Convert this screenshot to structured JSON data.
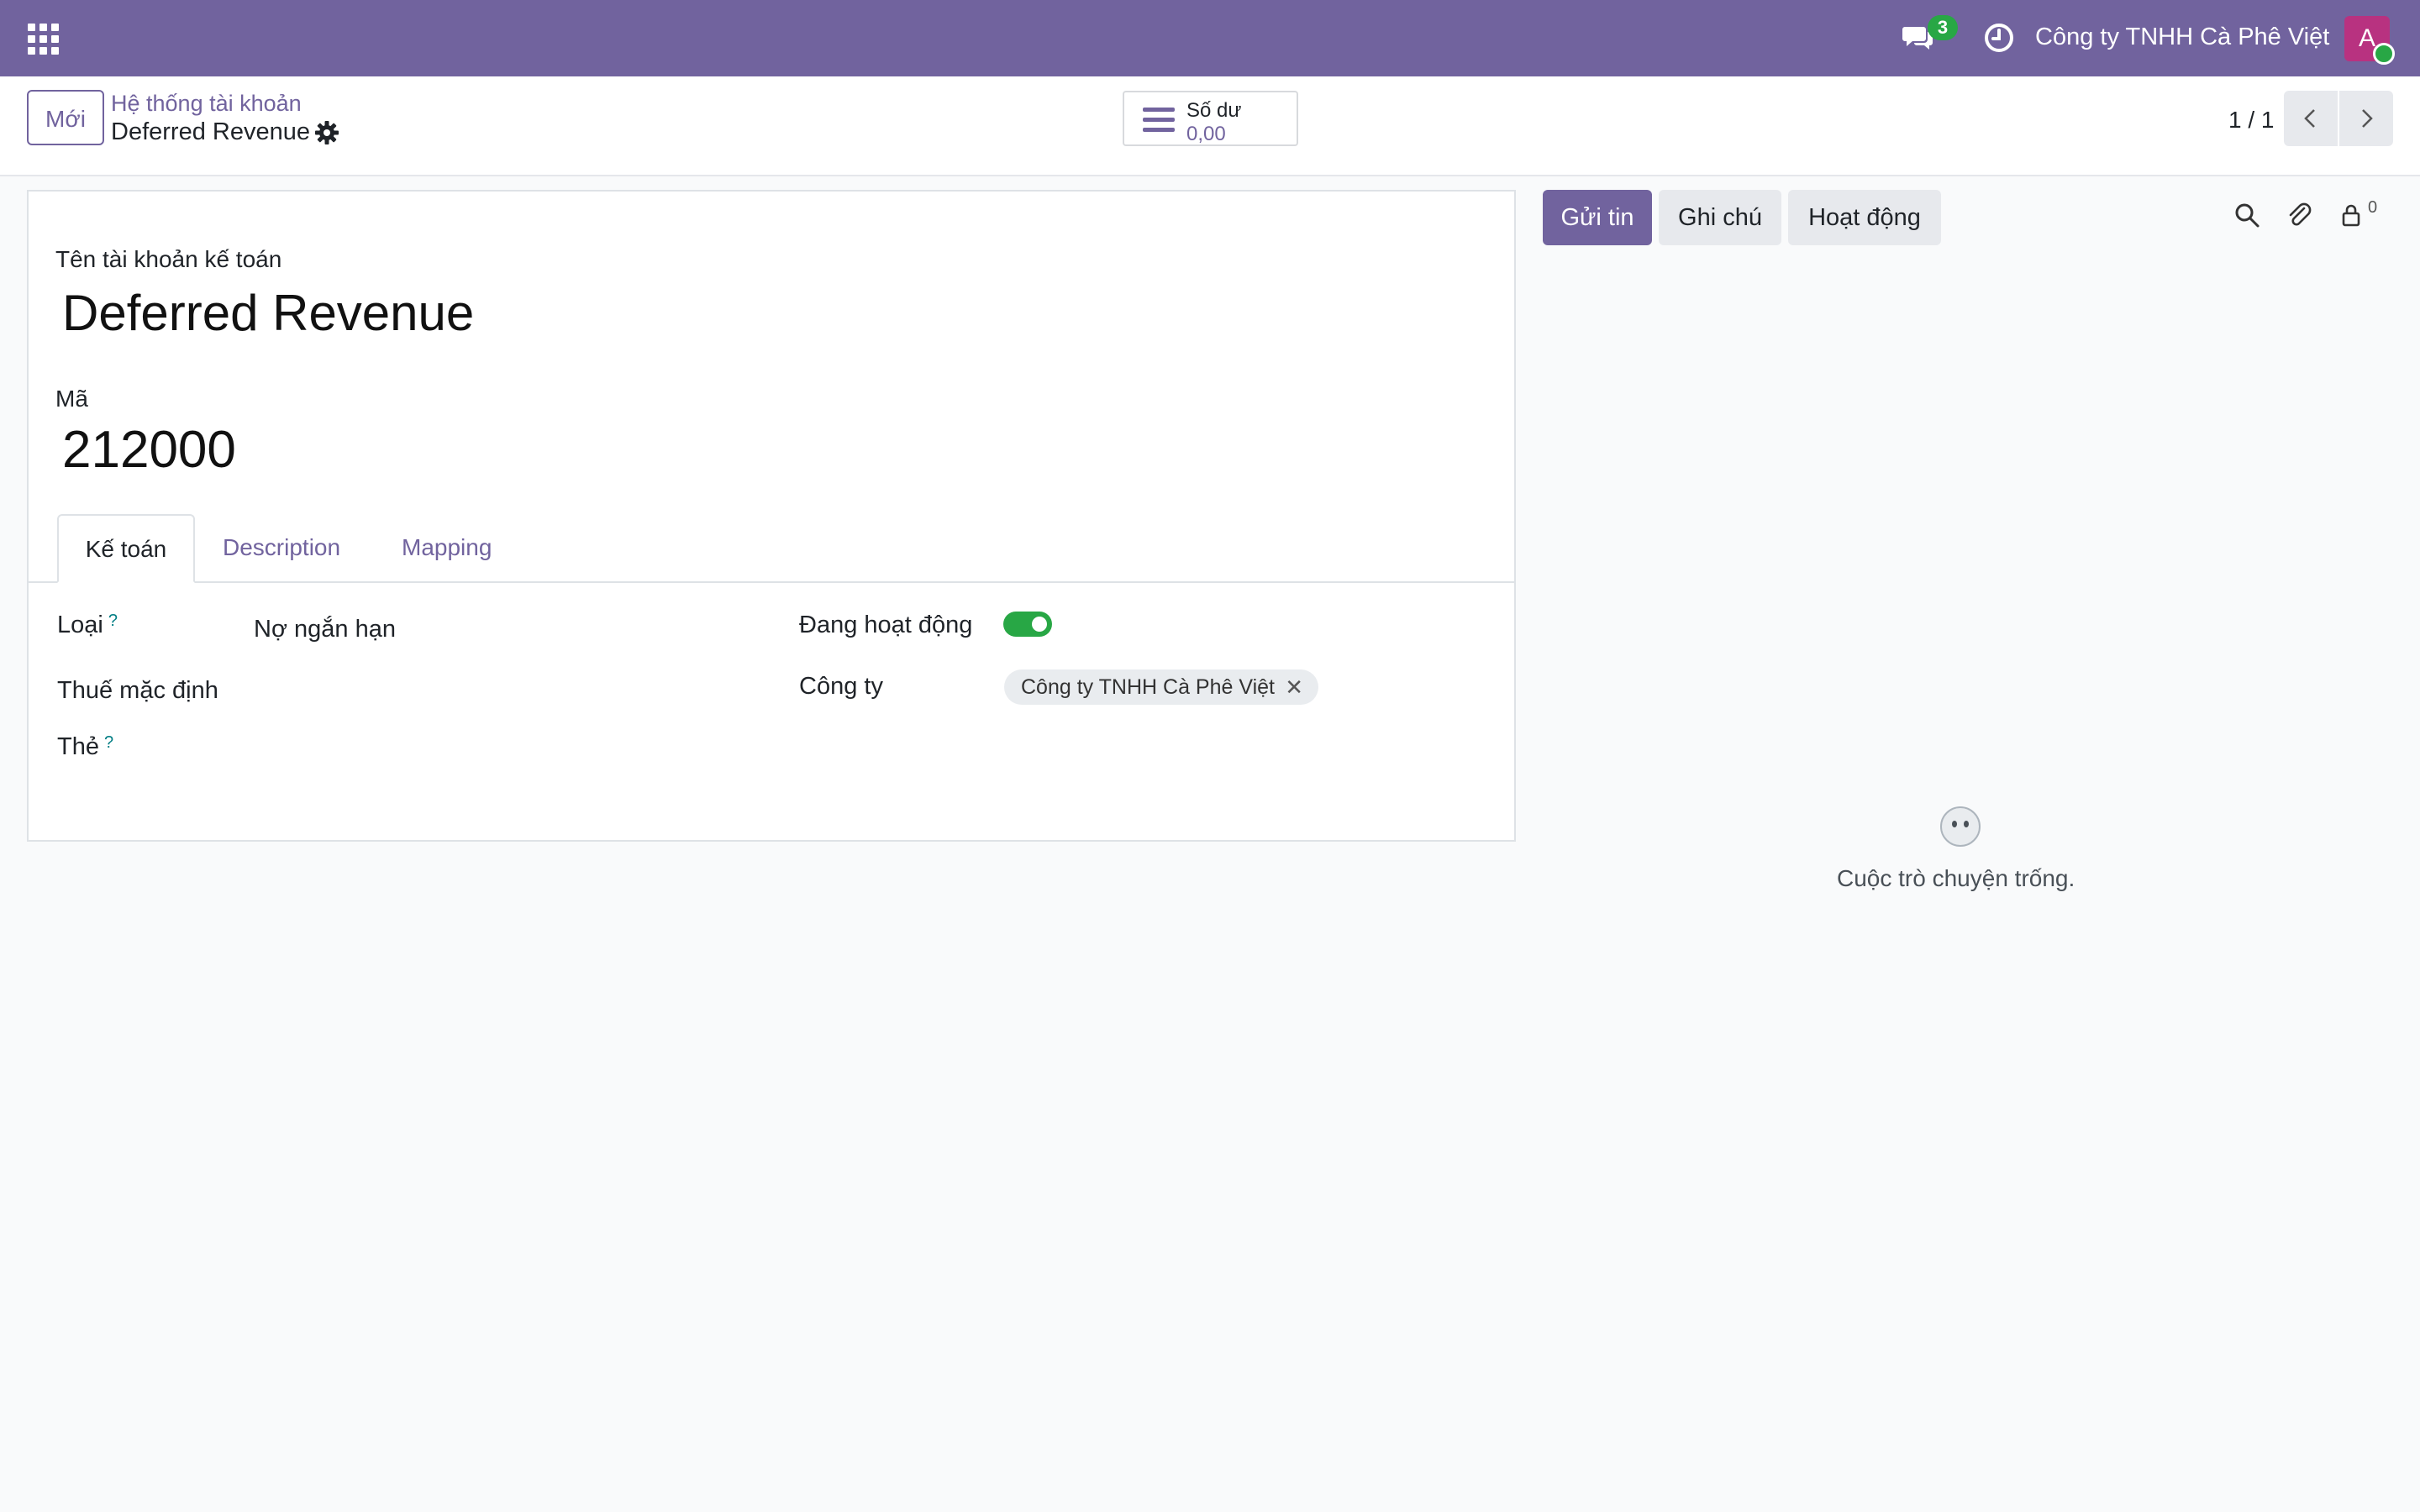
{
  "navbar": {
    "apps_icon": "grid-icon",
    "messages_badge": "3",
    "company_name": "Công ty TNHH Cà Phê Việt",
    "avatar_initial": "A",
    "accent_color": "#71639e"
  },
  "control_panel": {
    "new_button": "Mới",
    "breadcrumb_parent": "Hệ thống tài khoản",
    "breadcrumb_current": "Deferred Revenue",
    "stat_label": "Số dư",
    "stat_value": "0,00",
    "pager_value": "1 / 1"
  },
  "form": {
    "name_label": "Tên tài khoản kế toán",
    "name_value": "Deferred Revenue",
    "code_label": "Mã",
    "code_value": "212000",
    "tabs": [
      {
        "label": "Kế toán",
        "active": true
      },
      {
        "label": "Description",
        "active": false
      },
      {
        "label": "Mapping",
        "active": false
      }
    ],
    "fields": {
      "type_label": "Loại",
      "type_value": "Nợ ngắn hạn",
      "tax_label": "Thuế mặc định",
      "tags_label": "Thẻ",
      "help_mark": "?",
      "active_label": "Đang hoạt động",
      "active_value": true,
      "company_label": "Công ty",
      "company_tag": "Công ty TNHH Cà Phê Việt",
      "tag_remove": "✕"
    }
  },
  "chatter": {
    "send_button": "Gửi tin",
    "note_button": "Ghi chú",
    "activity_button": "Hoạt động",
    "followers_count": "0",
    "empty_message": "Cuộc trò chuyện trống."
  }
}
